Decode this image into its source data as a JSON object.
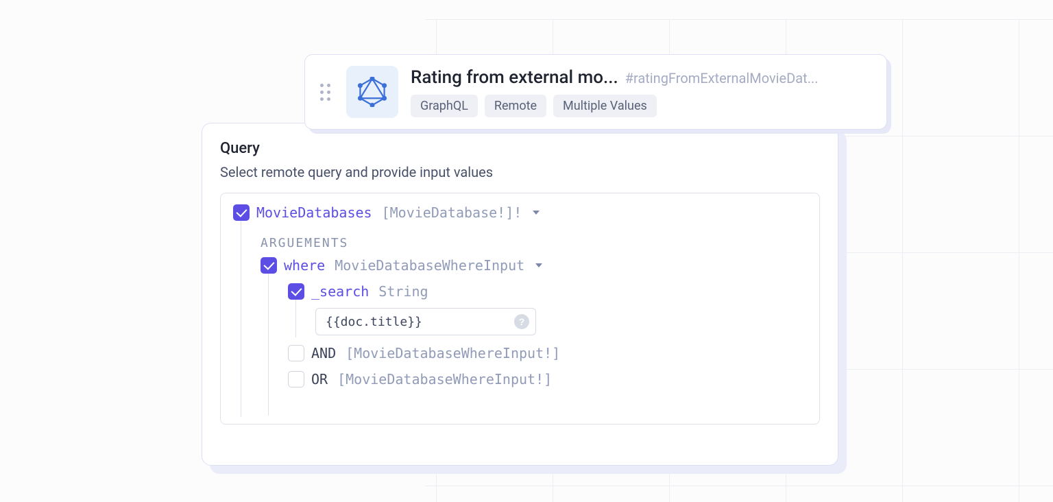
{
  "card": {
    "title": "Rating from external mo...",
    "alias": "#ratingFromExternalMovieDat...",
    "tags": [
      "GraphQL",
      "Remote",
      "Multiple Values"
    ]
  },
  "query": {
    "title": "Query",
    "subtitle": "Select remote query and provide input values",
    "root": {
      "name": "MovieDatabases",
      "type": "[MovieDatabase!]!"
    },
    "argsLabel": "ARGUEMENTS",
    "where": {
      "name": "where",
      "type": "MovieDatabaseWhereInput"
    },
    "search": {
      "name": "_search",
      "type": "String",
      "value": "{{doc.title}}"
    },
    "and_": {
      "name": "AND",
      "type": "[MovieDatabaseWhereInput!]"
    },
    "or_": {
      "name": "OR",
      "type": "[MovieDatabaseWhereInput!]"
    }
  }
}
